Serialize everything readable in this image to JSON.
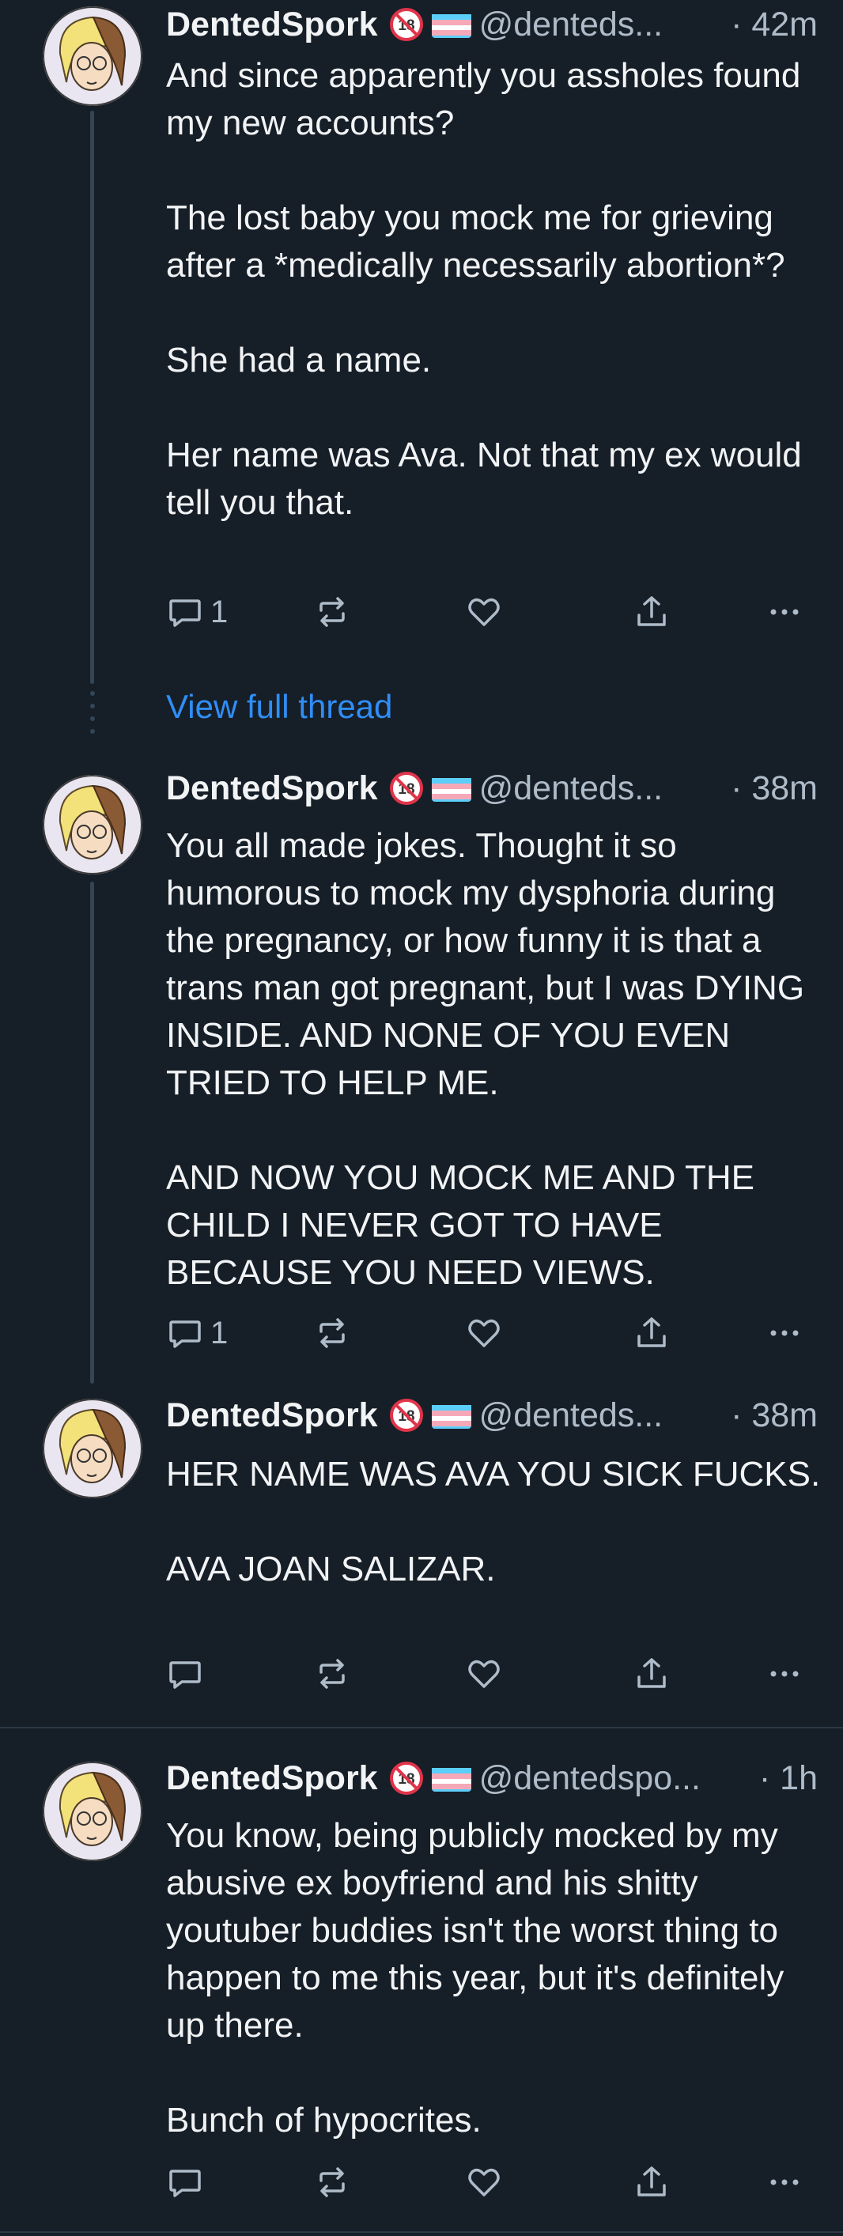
{
  "posts": [
    {
      "display_name": "DentedSpork",
      "handle": "@denteds...",
      "time": "· 42m",
      "text": "And since apparently you assholes found my new accounts?\n\nThe lost baby you mock me for grieving after a *medically necessarily abortion*?\n\nShe had a name.\n\nHer name was Ava. Not that my ex would tell you that.",
      "reply_count": "1"
    },
    {
      "display_name": "DentedSpork",
      "handle": "@denteds...",
      "time": "· 38m",
      "text": "You all made jokes. Thought it so humorous to mock my dysphoria during the pregnancy, or how funny it is that a trans man got pregnant, but I was DYING INSIDE. AND NONE OF YOU EVEN TRIED TO HELP ME.\n\nAND NOW YOU MOCK ME AND THE CHILD I NEVER GOT TO HAVE BECAUSE YOU NEED VIEWS.",
      "reply_count": "1"
    },
    {
      "display_name": "DentedSpork",
      "handle": "@denteds...",
      "time": "· 38m",
      "text": "HER NAME WAS AVA YOU SICK FUCKS.\n\nAVA JOAN SALIZAR.",
      "reply_count": ""
    },
    {
      "display_name": "DentedSpork",
      "handle": "@dentedspo...",
      "time": "· 1h",
      "text": "You know, being publicly mocked by my abusive ex boyfriend and his shitty youtuber buddies isn't the worst thing to happen to me this year, but it's definitely up there.\n\nBunch of hypocrites.",
      "reply_count": ""
    }
  ],
  "view_full_thread": "View full thread",
  "colors": {
    "background": "#161e27",
    "text": "#f1f3f5",
    "secondary": "#aebbc9",
    "link": "#2f8ef6",
    "thread_line": "#344555"
  },
  "icons": [
    "reply-icon",
    "repost-icon",
    "like-icon",
    "share-icon",
    "more-icon",
    "adult-content-icon",
    "trans-flag-icon"
  ]
}
